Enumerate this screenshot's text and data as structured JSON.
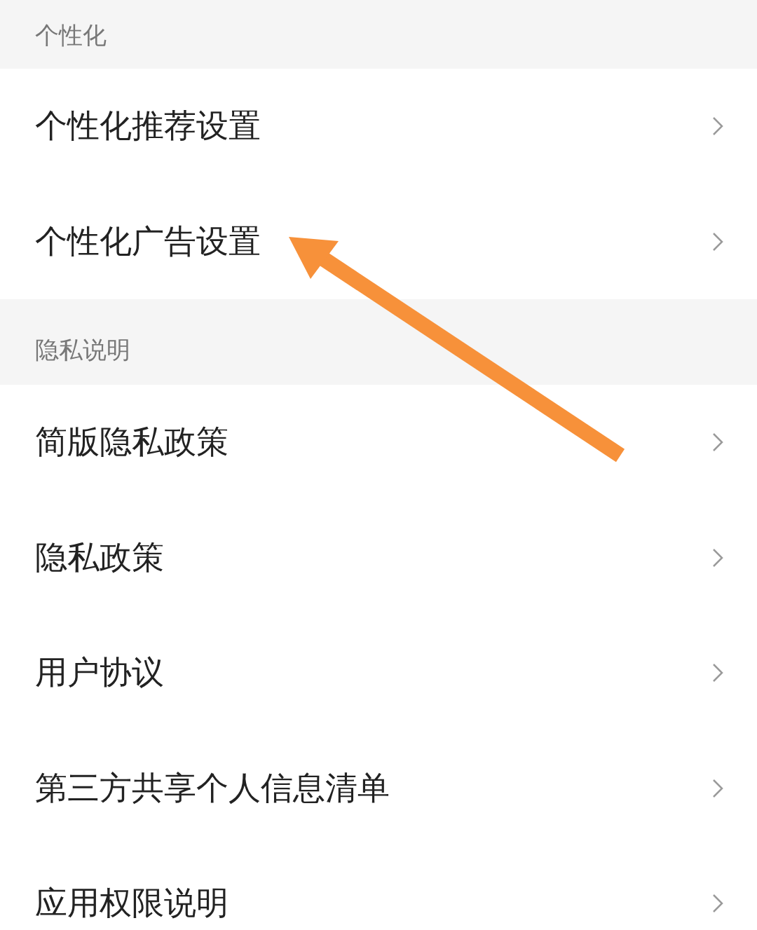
{
  "sections": [
    {
      "title": "个性化",
      "items": [
        {
          "label": "个性化推荐设置"
        },
        {
          "label": "个性化广告设置"
        }
      ]
    },
    {
      "title": "隐私说明",
      "items": [
        {
          "label": "简版隐私政策"
        },
        {
          "label": "隐私政策"
        },
        {
          "label": "用户协议"
        },
        {
          "label": "第三方共享个人信息清单"
        },
        {
          "label": "应用权限说明"
        }
      ]
    }
  ],
  "annotations": [
    {
      "kind": "arrow"
    }
  ]
}
